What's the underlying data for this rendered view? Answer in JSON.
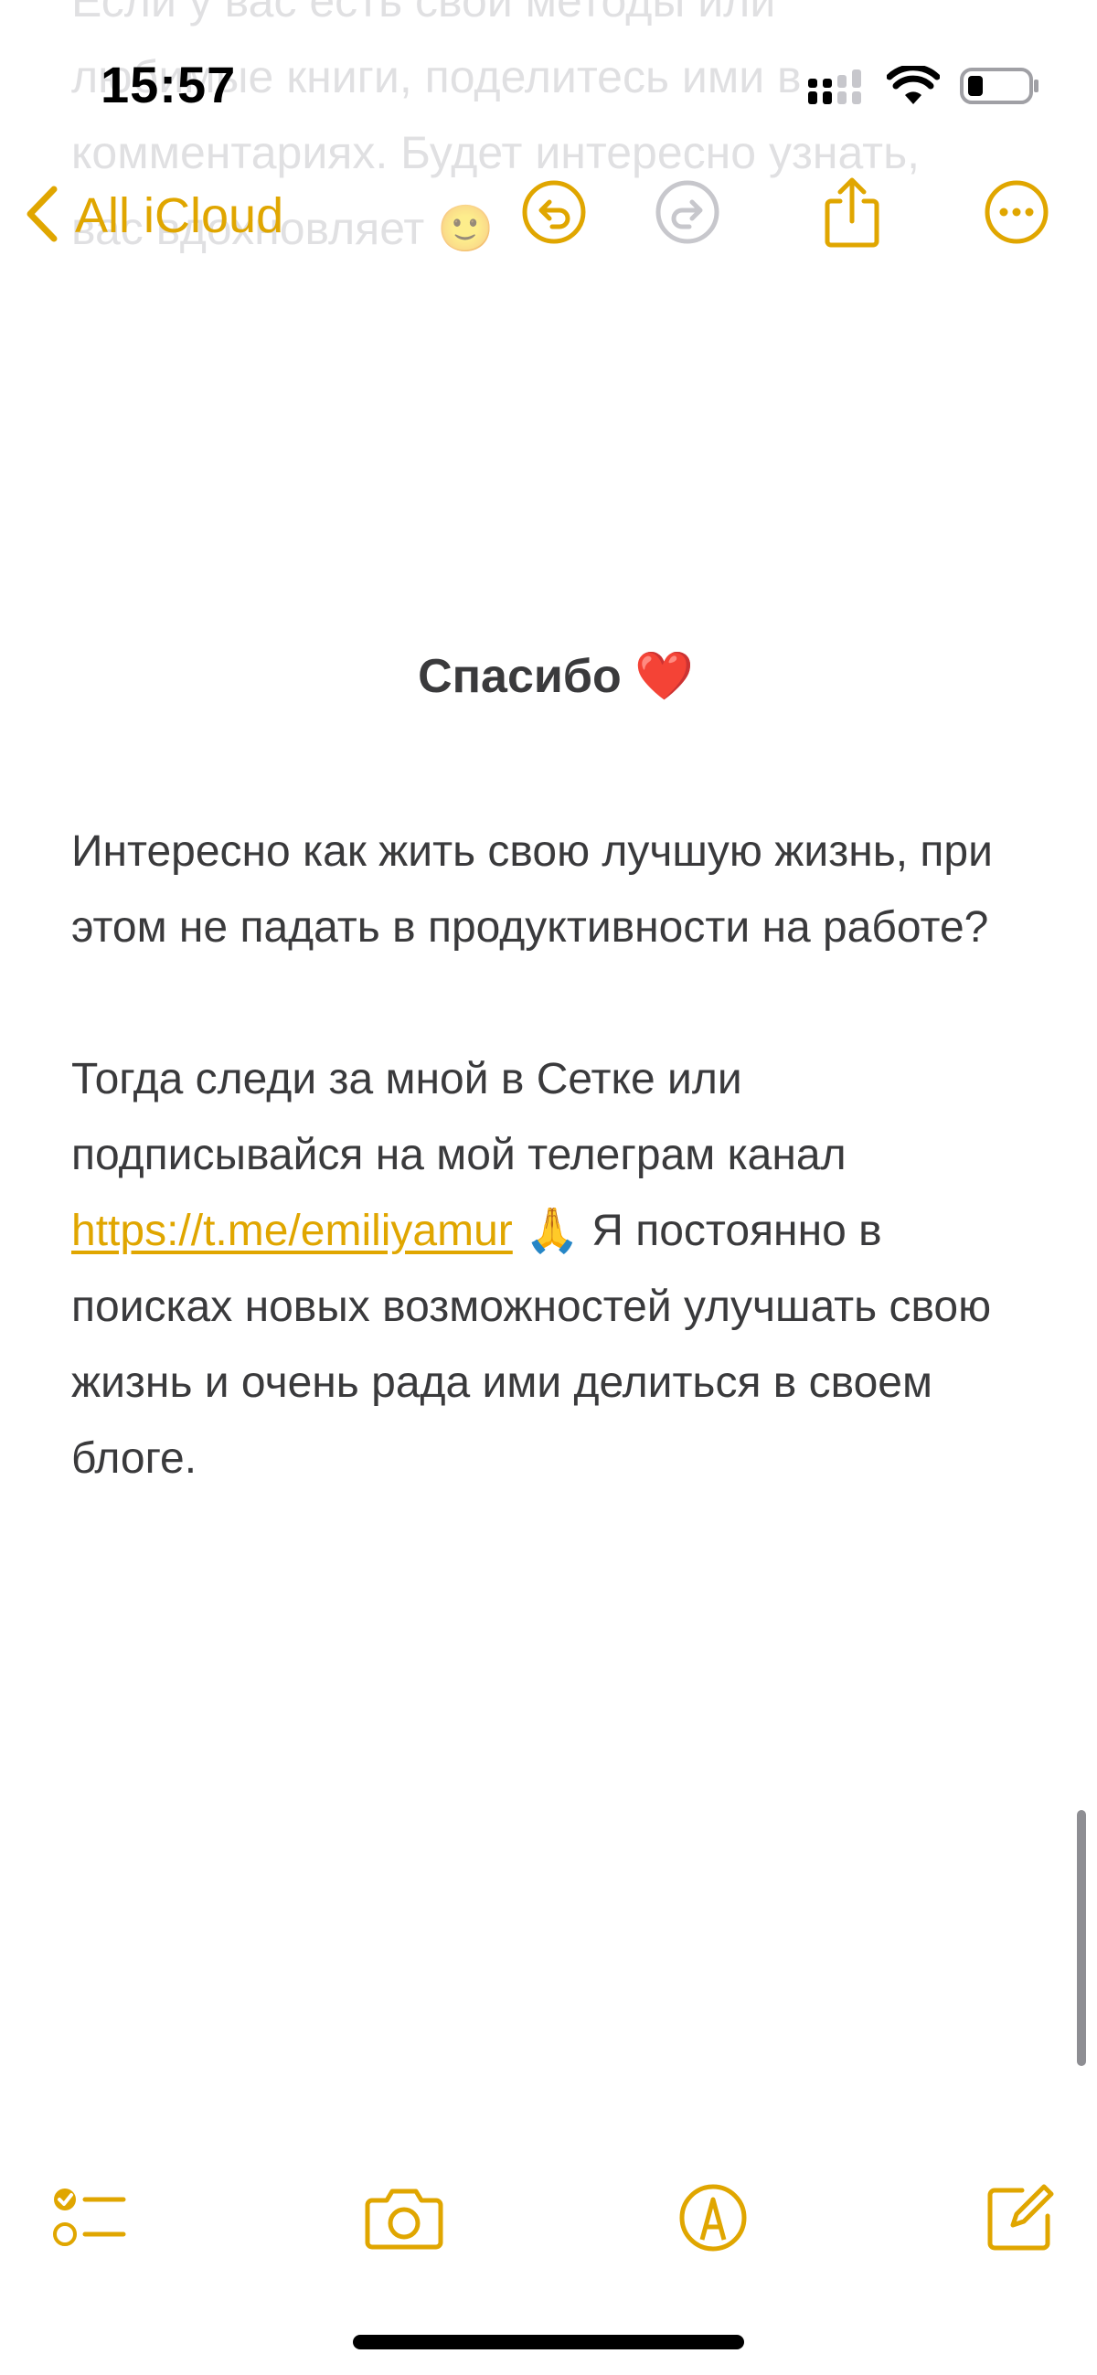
{
  "status_bar": {
    "time": "15:57",
    "icons": [
      "cellular-signal-icon",
      "wifi-icon",
      "battery-icon"
    ]
  },
  "ghost_text": "Если у вас есть свои методы или\nлюбимые книги, поделитесь ими в\nкомментариях. Будет интересно узнать,\nвас вдохновляет 🙂",
  "nav": {
    "back_label": "All iCloud",
    "icons": [
      "chevron-left-icon",
      "undo-icon",
      "redo-icon",
      "share-icon",
      "more-icon"
    ]
  },
  "note": {
    "heading": "Спасибо ❤️",
    "para1": "Интересно как жить свою лучшую жизнь, при этом не падать в продуктивности на работе?",
    "para2_before": "Тогда следи за мной в Сетке или подписывайся на мой телеграм канал ",
    "link_text": "https://t.me/emiliyamur",
    "para2_after": " 🙏 Я постоянно в поисках новых возможностей улучшать свою жизнь и очень рада ими делиться в своем блоге."
  },
  "toolbar": {
    "icons": [
      "checklist-icon",
      "camera-icon",
      "markup-icon",
      "compose-icon"
    ]
  },
  "colors": {
    "accent": "#e0a600",
    "text": "#3a3a3c",
    "background": "#ffffff"
  }
}
